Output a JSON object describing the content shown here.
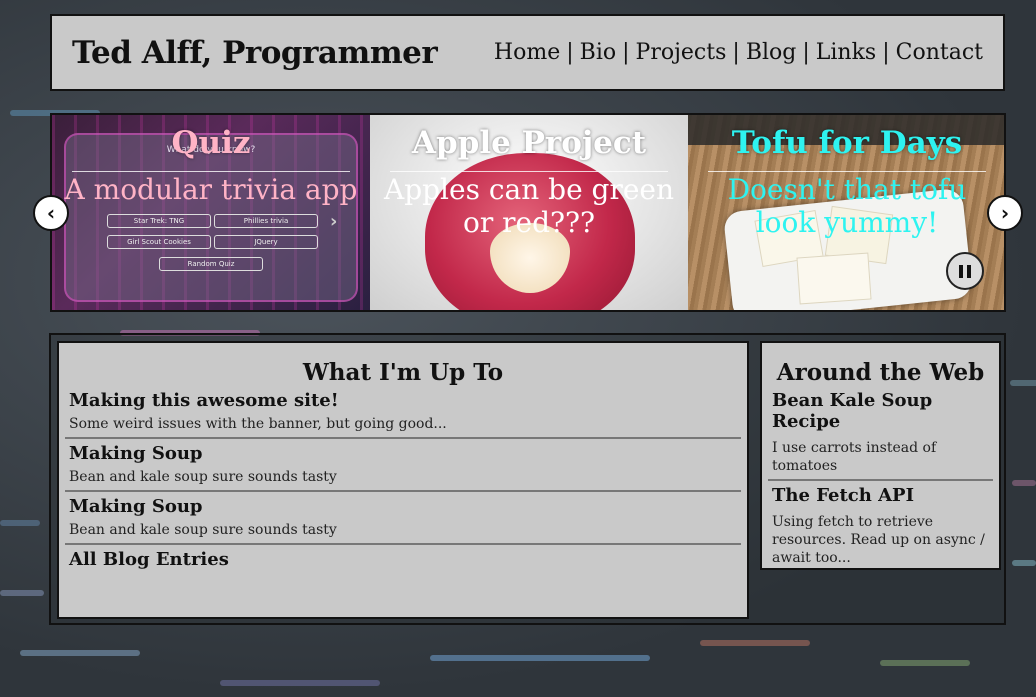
{
  "header": {
    "title": "Ted Alff, Programmer",
    "nav": [
      {
        "label": "Home"
      },
      {
        "label": "Bio"
      },
      {
        "label": "Projects"
      },
      {
        "label": "Blog"
      },
      {
        "label": "Links"
      },
      {
        "label": "Contact"
      }
    ],
    "separator": "|"
  },
  "carousel": {
    "slides": [
      {
        "title": "Quiz",
        "description": "A modular trivia app",
        "text_color": "#ffb3c6"
      },
      {
        "title": "Apple Project",
        "description": "Apples can be green or red???",
        "text_color": "#ffffff"
      },
      {
        "title": "Tofu for Days",
        "description": "Doesn't that tofu look yummy!",
        "text_color": "#2ef3f0"
      }
    ],
    "prev_icon": "chevron-left-icon",
    "next_icon": "chevron-right-icon",
    "pause_icon": "pause-icon",
    "quiz_screenshot": {
      "heading": "What do you know?",
      "buttons": [
        "Star Trek: TNG",
        "Phillies trivia",
        "Girl Scout Cookies",
        "JQuery"
      ],
      "random": "Random Quiz"
    }
  },
  "updates": {
    "heading": "What I'm Up To",
    "items": [
      {
        "title": "Making this awesome site!",
        "text": "Some weird issues with the banner, but going good..."
      },
      {
        "title": "Making Soup",
        "text": "Bean and kale soup sure sounds tasty"
      },
      {
        "title": "Making Soup",
        "text": "Bean and kale soup sure sounds tasty"
      }
    ],
    "all_link": "All Blog Entries"
  },
  "around_web": {
    "heading": "Around the Web",
    "items": [
      {
        "title": "Bean Kale Soup Recipe",
        "text": "I use carrots instead of tomatoes"
      },
      {
        "title": "The Fetch API",
        "text": "Using fetch to retrieve resources. Read up on async / await too..."
      }
    ]
  }
}
